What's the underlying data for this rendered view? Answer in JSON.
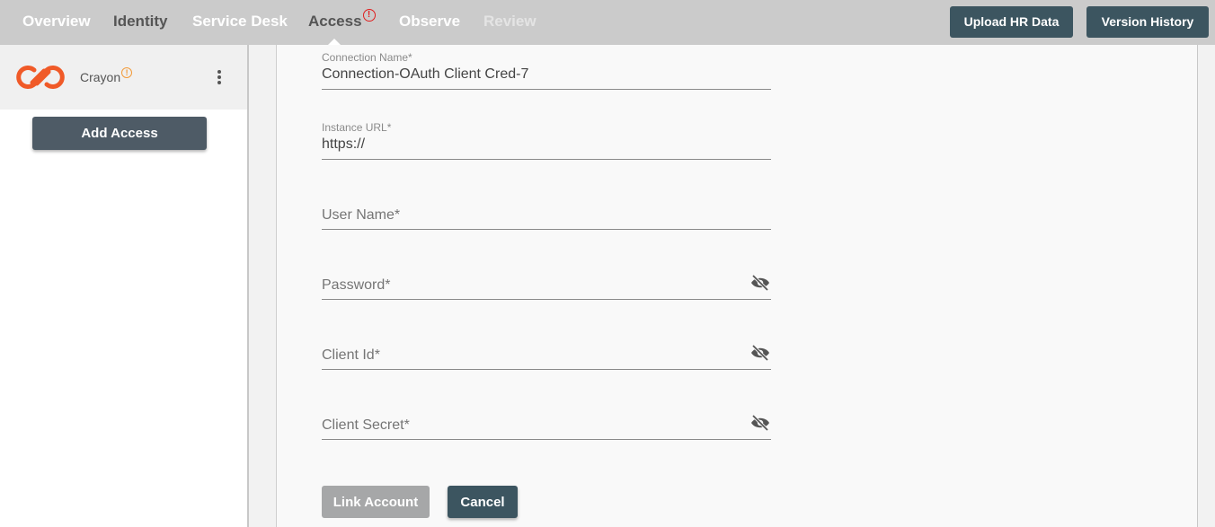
{
  "nav": {
    "items": [
      {
        "label": "Overview",
        "state": "normal"
      },
      {
        "label": "Identity",
        "state": "dark"
      },
      {
        "label": "Service Desk",
        "state": "normal"
      },
      {
        "label": "Access",
        "state": "active",
        "alert": "!"
      },
      {
        "label": "Observe",
        "state": "normal"
      },
      {
        "label": "Review",
        "state": "disabled"
      }
    ],
    "buttons": {
      "upload_hr": "Upload HR Data",
      "version_history": "Version History"
    }
  },
  "sidebar": {
    "app": {
      "name": "Crayon",
      "warning": "!",
      "logo_color": "#f05a28",
      "icon": "crayon-logo-icon"
    },
    "add_access_label": "Add Access"
  },
  "form": {
    "connection_name": {
      "label": "Connection Name*",
      "value": "Connection-OAuth Client Cred-7"
    },
    "instance_url": {
      "label": "Instance URL*",
      "value": "https://"
    },
    "user_name": {
      "placeholder": "User Name*",
      "value": ""
    },
    "password": {
      "placeholder": "Password*",
      "value": "",
      "icon": "eye-off-icon"
    },
    "client_id": {
      "placeholder": "Client Id*",
      "value": "",
      "icon": "eye-off-icon"
    },
    "client_secret": {
      "placeholder": "Client Secret*",
      "value": "",
      "icon": "eye-off-icon"
    },
    "link_account_label": "Link Account",
    "cancel_label": "Cancel"
  },
  "colors": {
    "topbar_bg": "#cbcbcb",
    "primary_button": "#3c5560",
    "disabled_button": "#a6a7a8",
    "alert_red": "#e02020",
    "warning_orange": "#f29b3a"
  }
}
